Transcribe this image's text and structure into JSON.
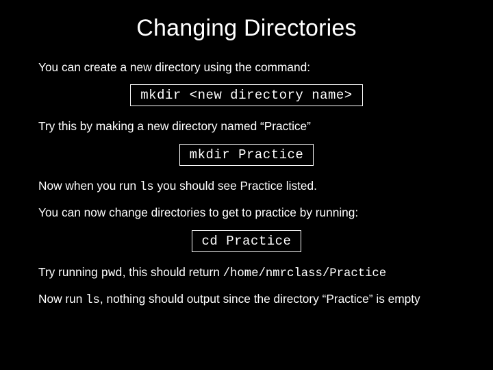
{
  "title": "Changing Directories",
  "p1": "You can create a new directory using the command:",
  "cmd1": "mkdir <new directory name>",
  "p2": "Try this by making a new directory named “Practice”",
  "cmd2": "mkdir Practice",
  "p3_a": "Now when you run ",
  "p3_code": "ls",
  "p3_b": " you should see Practice listed.",
  "p4": "You can now change directories to get to practice by running:",
  "cmd3": "cd Practice",
  "p5_a": "Try running ",
  "p5_code1": "pwd",
  "p5_b": ", this should return  ",
  "p5_code2": "/home/nmrclass/Practice",
  "p6_a": "Now run ",
  "p6_code": "ls",
  "p6_b": ", nothing should output since the directory “Practice” is empty"
}
